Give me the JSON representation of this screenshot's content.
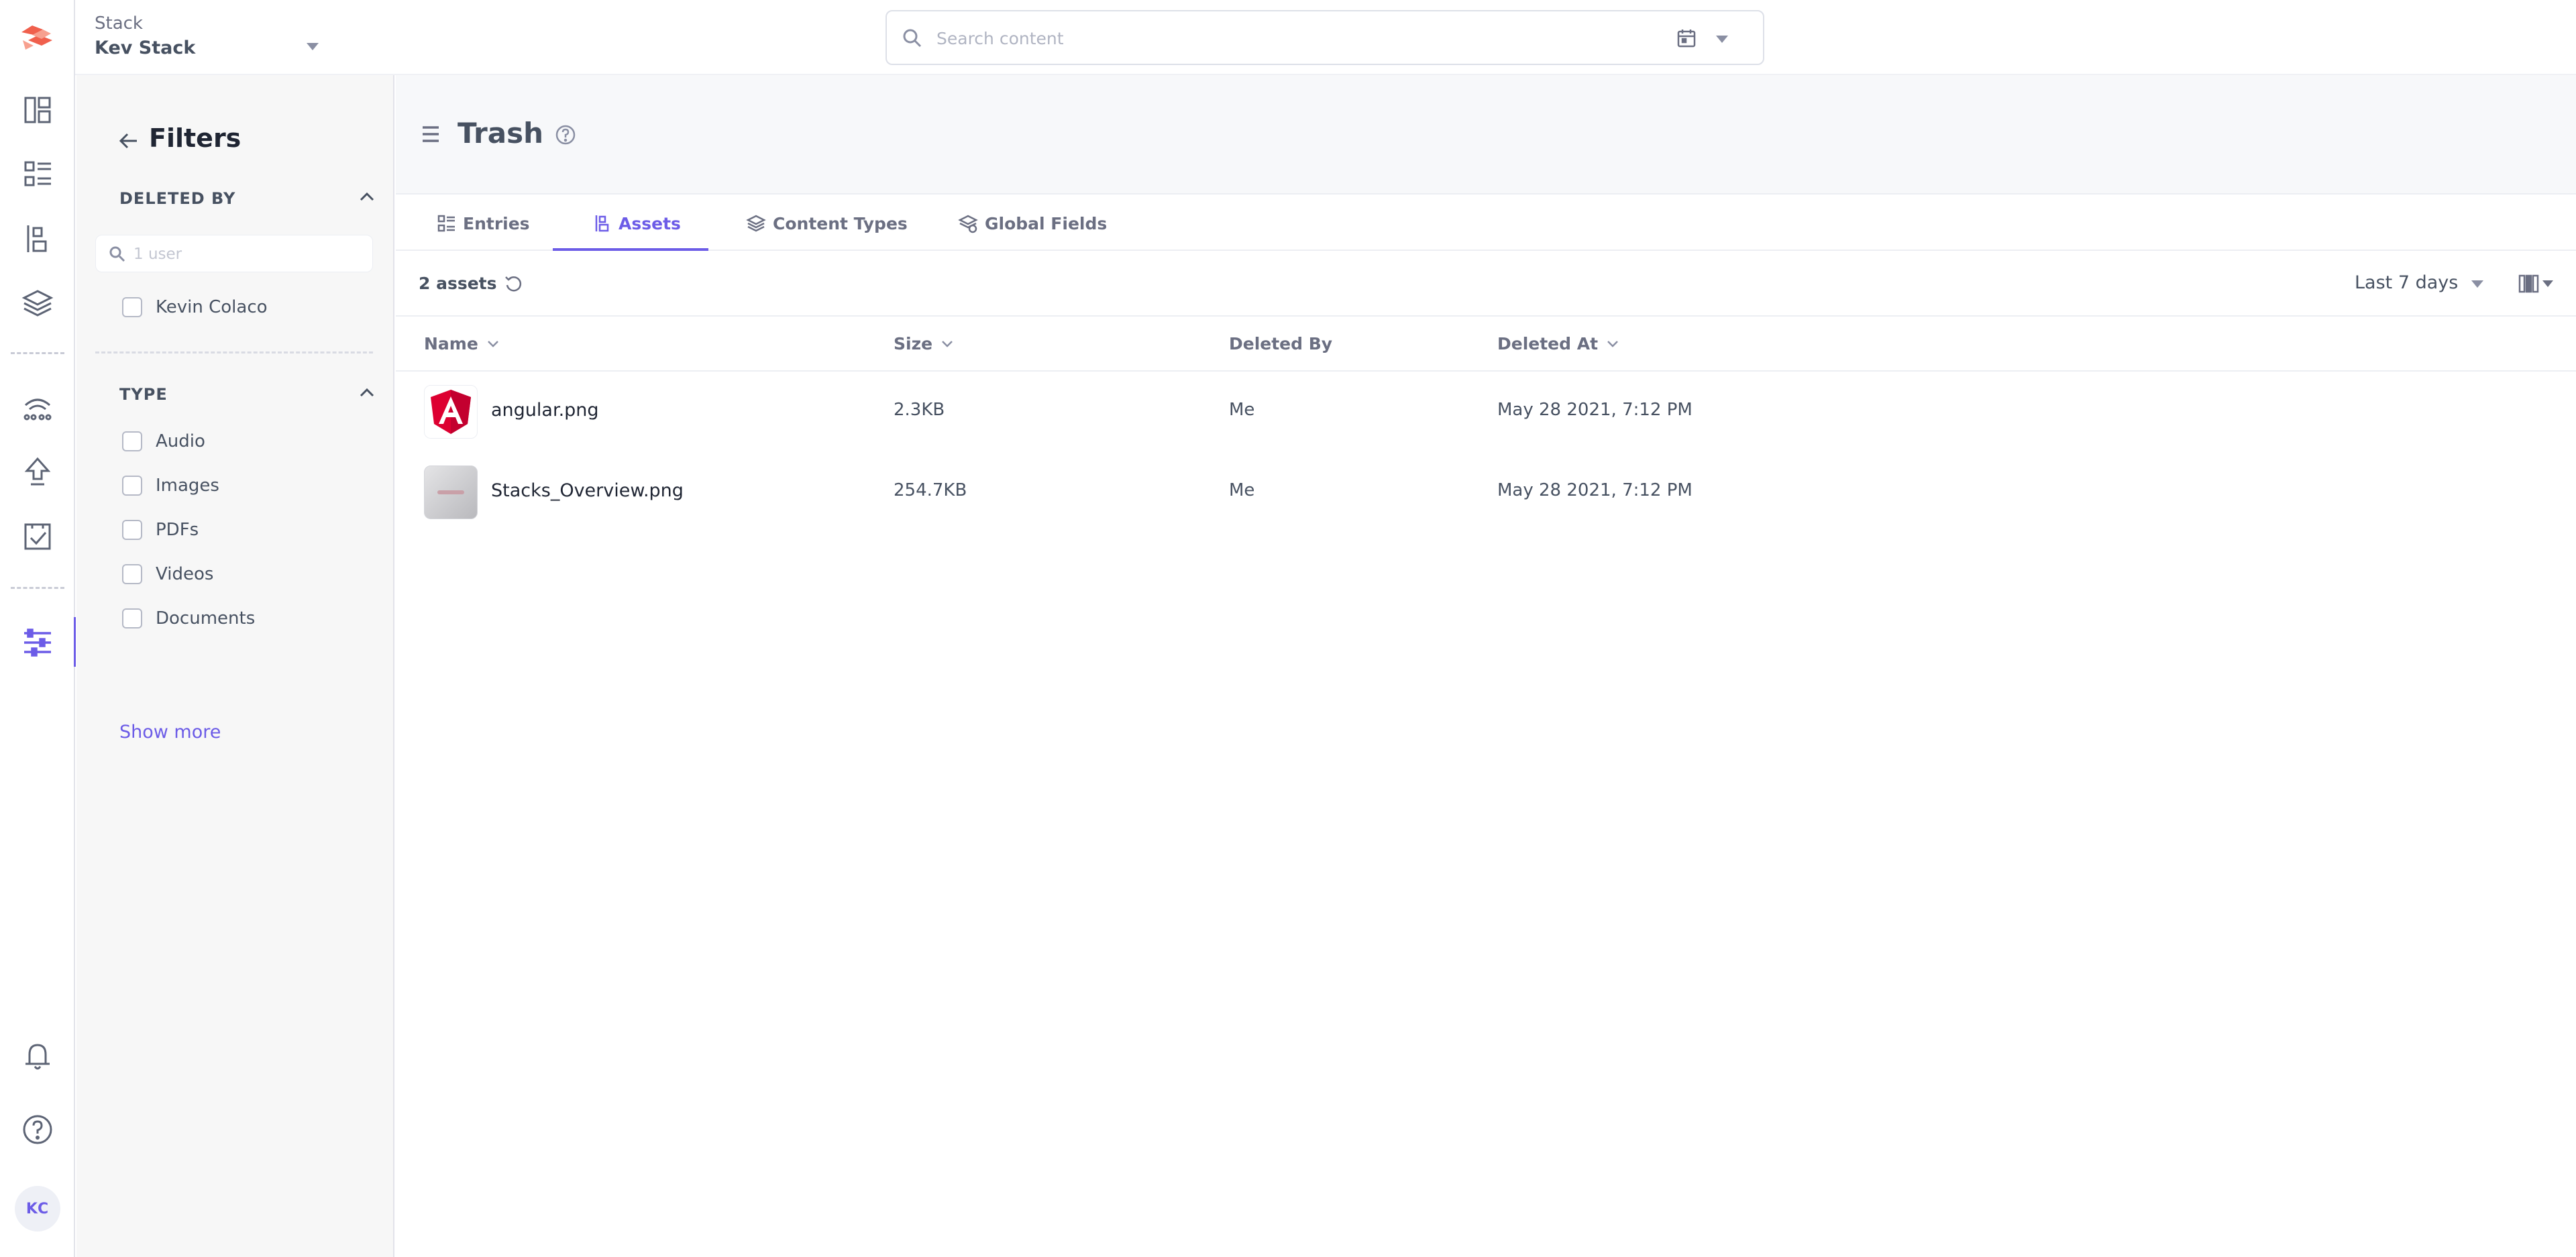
{
  "app": {
    "stack_label": "Stack",
    "stack_name": "Kev Stack",
    "user_initials": "KC"
  },
  "search": {
    "placeholder": "Search content"
  },
  "sidebar_icons": [
    "dashboard-icon",
    "entries-icon",
    "assets-icon",
    "content-models-icon",
    "extensions-icon",
    "deploy-icon",
    "tasks-icon",
    "settings-icon",
    "bell-icon",
    "help-icon"
  ],
  "filters": {
    "title": "Filters",
    "deleted_by": {
      "title": "DELETED BY",
      "search_placeholder": "1 user",
      "users": [
        "Kevin Colaco"
      ]
    },
    "type": {
      "title": "TYPE",
      "options": [
        "Audio",
        "Images",
        "PDFs",
        "Videos",
        "Documents"
      ],
      "show_more": "Show more"
    }
  },
  "page": {
    "title": "Trash"
  },
  "tabs": [
    {
      "label": "Entries",
      "active": false
    },
    {
      "label": "Assets",
      "active": true
    },
    {
      "label": "Content Types",
      "active": false
    },
    {
      "label": "Global Fields",
      "active": false
    }
  ],
  "toolbar": {
    "count": "2 assets",
    "range": "Last 7 days"
  },
  "table": {
    "columns": [
      "Name",
      "Size",
      "Deleted By",
      "Deleted At"
    ],
    "rows": [
      {
        "name": "angular.png",
        "size": "2.3KB",
        "deleted_by": "Me",
        "deleted_at": "May 28 2021, 7:12 PM",
        "thumb": "angular-logo"
      },
      {
        "name": "Stacks_Overview.png",
        "size": "254.7KB",
        "deleted_by": "Me",
        "deleted_at": "May 28 2021, 7:12 PM",
        "thumb": "screenshot"
      }
    ]
  },
  "colors": {
    "accent": "#6c5ce7",
    "text": "#475161",
    "logo": "#f0604d"
  }
}
